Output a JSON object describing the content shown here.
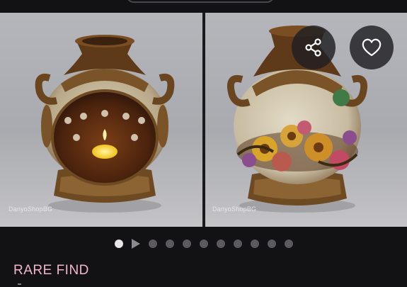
{
  "gallery": {
    "watermark_left": "DanyoShopBG",
    "watermark_right": "DanyoShopBG",
    "photos": [
      {
        "subject": "ceramic-vase-candle-holder"
      },
      {
        "subject": "ceramic-vase-floral"
      }
    ],
    "page_count": 11,
    "current_index": 0,
    "video_index": 1
  },
  "actions": {
    "share_icon": "share-icon",
    "favorite_icon": "heart-icon"
  },
  "listing": {
    "badge": "RARE FIND"
  },
  "colors": {
    "background": "#121113",
    "badge": "#f2b7cd",
    "dot_active": "#e9e7ea",
    "dot_inactive": "#5c5a5e"
  }
}
